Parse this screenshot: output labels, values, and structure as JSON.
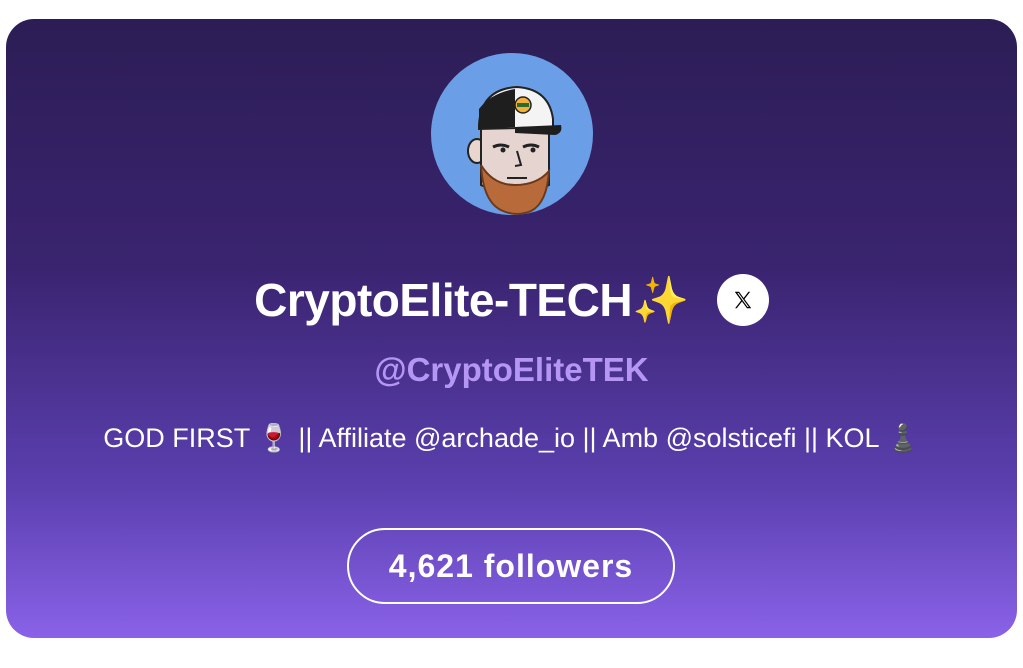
{
  "profile": {
    "avatar_icon": "avatar-cartoon-man-cap-icon",
    "display_name": "CryptoElite-TECH✨",
    "platform_icon": "x-logo-icon",
    "handle": "@CryptoEliteTEK",
    "bio": "GOD FIRST 🍷 || Affiliate @archade_io || Amb @solsticefi || KOL ♟️",
    "followers_label": "4,621 followers"
  },
  "colors": {
    "card_gradient_top": "#2c1d55",
    "card_gradient_bottom": "#8a62e8",
    "handle": "#b596f5",
    "avatar_bg": "#6a9ee6"
  }
}
